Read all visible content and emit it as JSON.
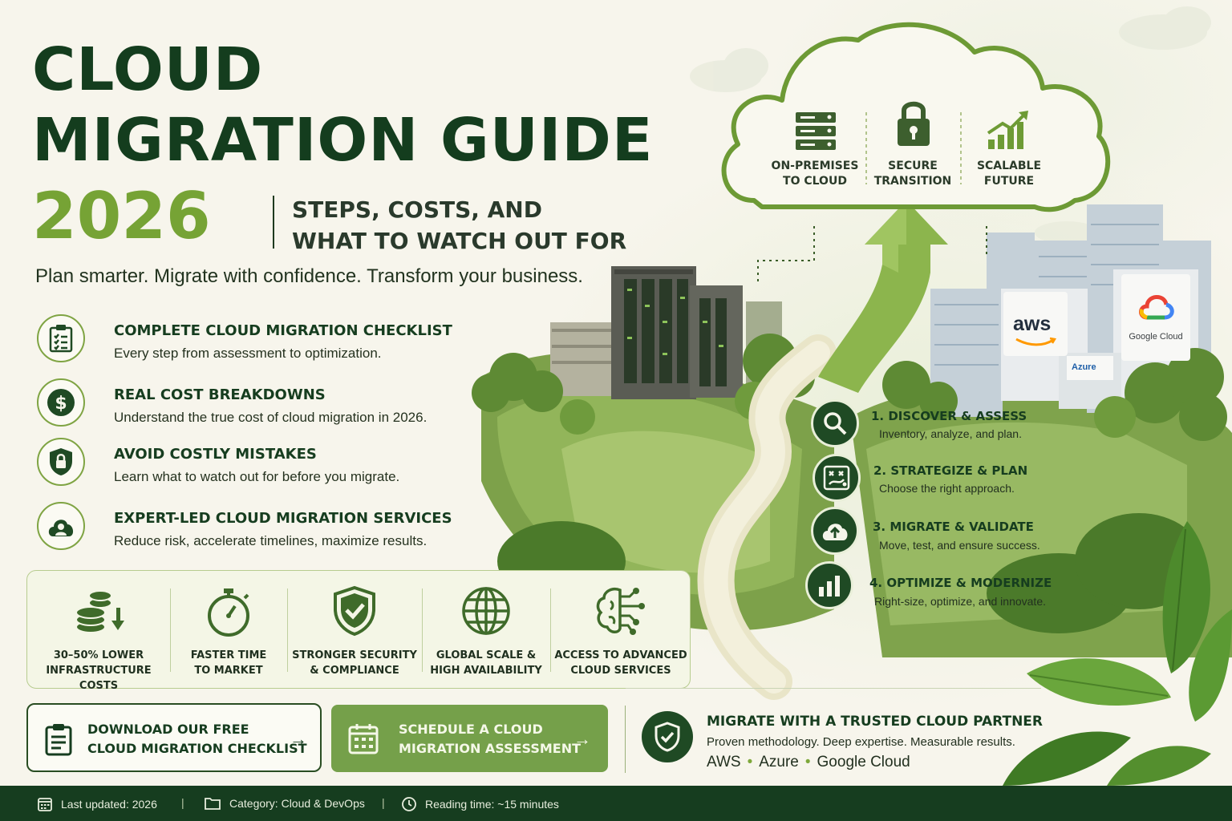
{
  "header": {
    "title_line1": "CLOUD",
    "title_line2": "MIGRATION GUIDE",
    "year": "2026",
    "subtitle_line1": "STEPS, COSTS, AND",
    "subtitle_line2": "WHAT TO WATCH OUT FOR",
    "tagline": "Plan smarter. Migrate with confidence. Transform your business."
  },
  "features": [
    {
      "icon": "checklist-icon",
      "title": "COMPLETE CLOUD MIGRATION CHECKLIST",
      "desc": "Every step from assessment to optimization."
    },
    {
      "icon": "dollar-icon",
      "title": "REAL COST BREAKDOWNS",
      "desc": "Understand the true cost of cloud migration in 2026."
    },
    {
      "icon": "shield-lock-icon",
      "title": "AVOID COSTLY MISTAKES",
      "desc": "Learn what to watch out for before you migrate."
    },
    {
      "icon": "cloud-user-icon",
      "title": "EXPERT-LED CLOUD MIGRATION SERVICES",
      "desc": "Reduce risk, accelerate timelines, maximize results."
    }
  ],
  "benefits": [
    {
      "icon": "coins-down-icon",
      "line1": "30–50% LOWER",
      "line2": "INFRASTRUCTURE COSTS"
    },
    {
      "icon": "stopwatch-icon",
      "line1": "FASTER TIME",
      "line2": "TO MARKET"
    },
    {
      "icon": "shield-check-icon",
      "line1": "STRONGER SECURITY",
      "line2": "& COMPLIANCE"
    },
    {
      "icon": "globe-icon",
      "line1": "GLOBAL SCALE &",
      "line2": "HIGH AVAILABILITY"
    },
    {
      "icon": "brain-circuit-icon",
      "line1": "ACCESS TO ADVANCED",
      "line2": "CLOUD SERVICES"
    }
  ],
  "cta": {
    "download_line1": "DOWNLOAD OUR FREE",
    "download_line2": "CLOUD MIGRATION CHECKLIST",
    "schedule_line1": "SCHEDULE A CLOUD",
    "schedule_line2": "MIGRATION ASSESSMENT",
    "arrow": "→"
  },
  "partner": {
    "title": "MIGRATE WITH A TRUSTED CLOUD PARTNER",
    "desc": "Proven methodology. Deep expertise. Measurable results.",
    "providers": [
      "AWS",
      "Azure",
      "Google Cloud"
    ],
    "separator": "•"
  },
  "cloud_items": [
    {
      "icon": "server-icon",
      "line1": "ON-PREMISES",
      "line2": "TO CLOUD"
    },
    {
      "icon": "padlock-icon",
      "line1": "SECURE",
      "line2": "TRANSITION"
    },
    {
      "icon": "growth-chart-icon",
      "line1": "SCALABLE",
      "line2": "FUTURE"
    }
  ],
  "steps": [
    {
      "icon": "magnifier-icon",
      "title": "1. DISCOVER & ASSESS",
      "desc": "Inventory, analyze, and plan."
    },
    {
      "icon": "strategy-board-icon",
      "title": "2. STRATEGIZE & PLAN",
      "desc": "Choose the right approach."
    },
    {
      "icon": "cloud-upload-icon",
      "title": "3. MIGRATE & VALIDATE",
      "desc": "Move, test, and ensure success."
    },
    {
      "icon": "bar-chart-icon",
      "title": "4. OPTIMIZE & MODERNIZE",
      "desc": "Right-size, optimize, and innovate."
    }
  ],
  "provider_signs": {
    "aws": "aws",
    "google": "Google Cloud",
    "azure": "Azure"
  },
  "footer": {
    "updated": "Last updated: 2026",
    "category": "Category: Cloud & DevOps",
    "reading": "Reading time: ~15 minutes",
    "separator": "|"
  },
  "colors": {
    "dark_green": "#163d1f",
    "accent_green": "#76a335",
    "button_green": "#75a04a",
    "background": "#f7f5ec"
  }
}
